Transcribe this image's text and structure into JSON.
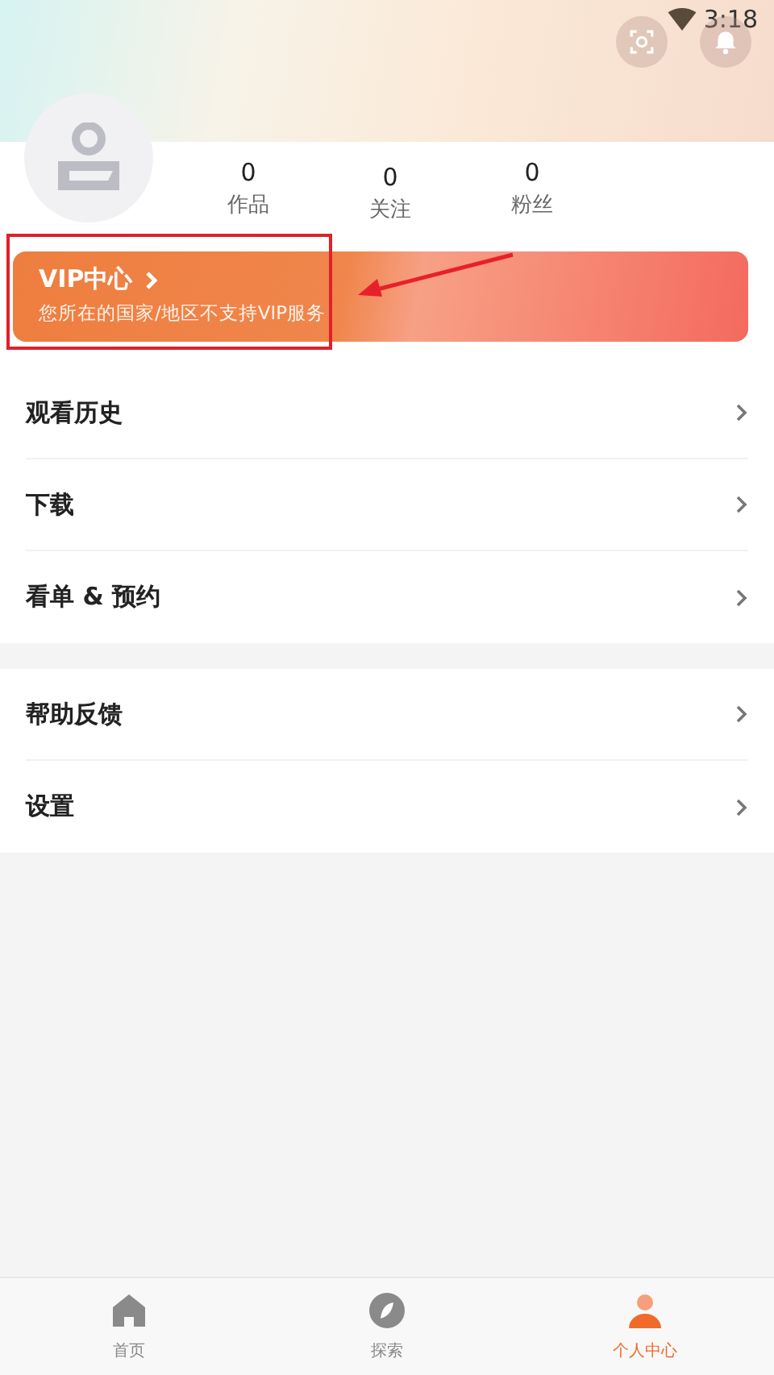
{
  "status_bar": {
    "time": "3:18"
  },
  "profile": {
    "stats": [
      {
        "value": "0",
        "label": "作品"
      },
      {
        "value": "0",
        "label": "关注"
      },
      {
        "value": "0",
        "label": "粉丝"
      }
    ]
  },
  "vip": {
    "title": "VIP中心",
    "subtitle": "您所在的国家/地区不支持VIP服务"
  },
  "menu_groups": [
    [
      {
        "label": "观看历史"
      },
      {
        "label": "下载"
      },
      {
        "label": "看单 & 预约"
      }
    ],
    [
      {
        "label": "帮助反馈"
      },
      {
        "label": "设置"
      }
    ]
  ],
  "bottom_nav": [
    {
      "label": "首页",
      "selected": false
    },
    {
      "label": "探索",
      "selected": false
    },
    {
      "label": "个人中心",
      "selected": true
    }
  ]
}
